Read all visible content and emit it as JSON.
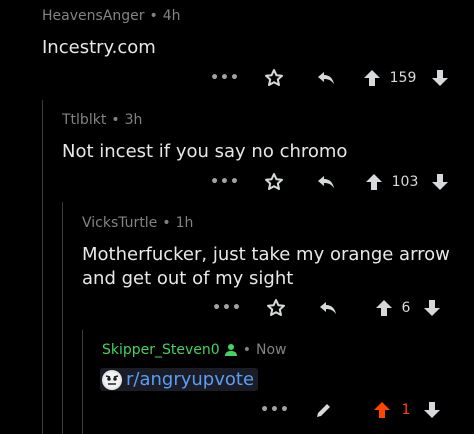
{
  "comments": [
    {
      "author": "HeavensAnger",
      "time": "4h",
      "body": "Incestry.com",
      "score": "159",
      "colors": {
        "author": "#818384"
      }
    },
    {
      "author": "Ttlblkt",
      "time": "3h",
      "body": "Not incest if you say no chromo",
      "score": "103",
      "colors": {
        "author": "#818384"
      }
    },
    {
      "author": "VicksTurtle",
      "time": "1h",
      "body_line1": "Motherfucker, just take my orange arrow",
      "body_line2": "and get out of my sight",
      "score": "6",
      "colors": {
        "author": "#818384"
      }
    },
    {
      "author": "Skipper_Steven0",
      "time": "Now",
      "link": "r/angryupvote",
      "score": "1",
      "colors": {
        "author": "#46d160",
        "upvoted": "#ff4500",
        "link": "#5b9cf5"
      }
    }
  ],
  "separator": "•",
  "more_label": "•••",
  "icons": [
    "more-icon",
    "award-icon",
    "reply-icon",
    "edit-icon",
    "upvote-arrow-icon",
    "downvote-arrow-icon",
    "user-icon",
    "subreddit-avatar-icon"
  ]
}
